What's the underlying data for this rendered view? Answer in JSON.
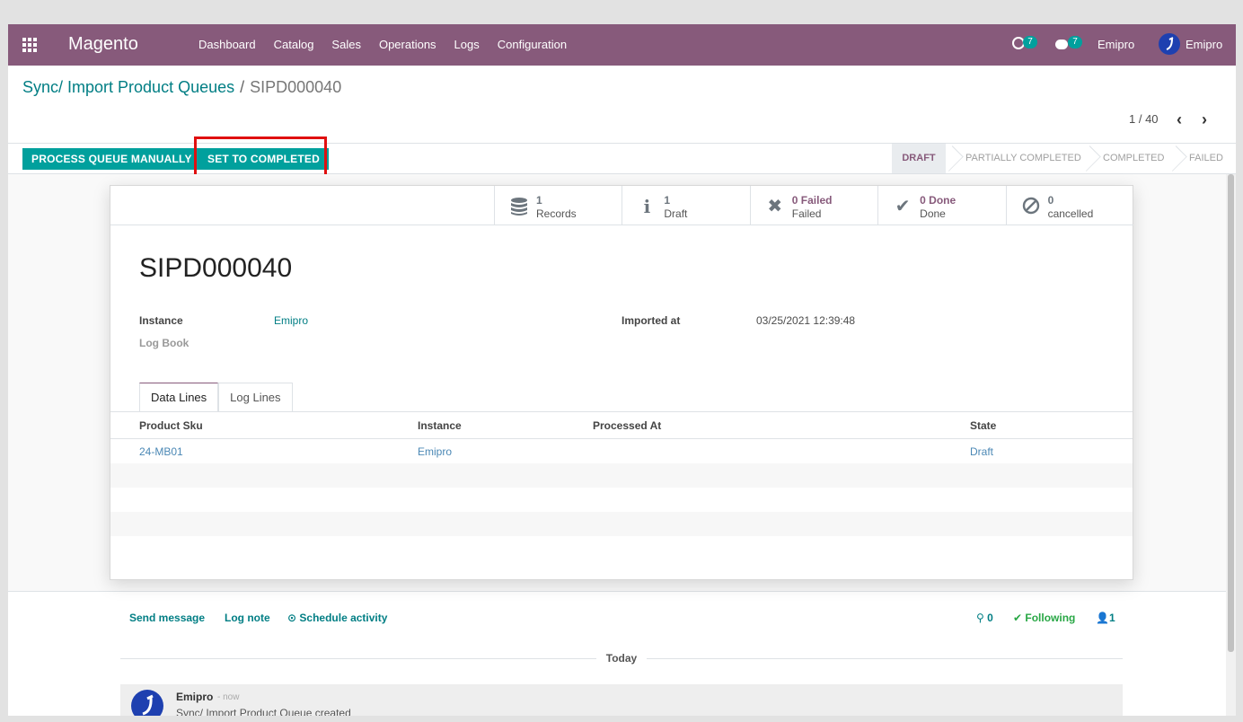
{
  "topnav": {
    "brand": "Magento",
    "menu": [
      "Dashboard",
      "Catalog",
      "Sales",
      "Operations",
      "Logs",
      "Configuration"
    ],
    "activity_count": "7",
    "message_count": "7",
    "company": "Emipro",
    "user": "Emipro"
  },
  "breadcrumb": {
    "parent": "Sync/ Import Product Queues",
    "separator": "/",
    "current": "SIPD000040"
  },
  "pager": {
    "text": "1 / 40"
  },
  "buttons": {
    "process": "PROCESS QUEUE MANUALLY",
    "complete": "SET TO COMPLETED"
  },
  "stages": [
    "DRAFT",
    "PARTIALLY COMPLETED",
    "COMPLETED",
    "FAILED"
  ],
  "stats": [
    {
      "num": "1",
      "label": "Records",
      "icon": "database-icon"
    },
    {
      "num": "1",
      "label": "Draft",
      "icon": "info-icon"
    },
    {
      "num": "0 Failed",
      "label": "Failed",
      "icon": "times-icon"
    },
    {
      "num": "0 Done",
      "label": "Done",
      "icon": "check-icon"
    },
    {
      "num": "0",
      "label": "cancelled",
      "icon": "ban-icon"
    }
  ],
  "record": {
    "name": "SIPD000040",
    "instance_label": "Instance",
    "instance_value": "Emipro",
    "logbook_label": "Log Book",
    "imported_label": "Imported at",
    "imported_value": "03/25/2021 12:39:48"
  },
  "tabs": [
    "Data Lines",
    "Log Lines"
  ],
  "table": {
    "headers": [
      "Product Sku",
      "Instance",
      "Processed At",
      "State"
    ],
    "rows": [
      {
        "sku": "24-MB01",
        "instance": "Emipro",
        "processed": "",
        "state": "Draft"
      }
    ]
  },
  "chatter": {
    "send": "Send message",
    "log": "Log note",
    "schedule": "Schedule activity",
    "attachments": "0",
    "following": "Following",
    "followers": "1",
    "today": "Today",
    "author": "Emipro",
    "time": "- now",
    "body": "Sync/ Import Product Queue created"
  },
  "colors": {
    "nav": "#875a7b",
    "primary": "#00a09d",
    "link": "#017e84",
    "highlight": "#e01010"
  }
}
